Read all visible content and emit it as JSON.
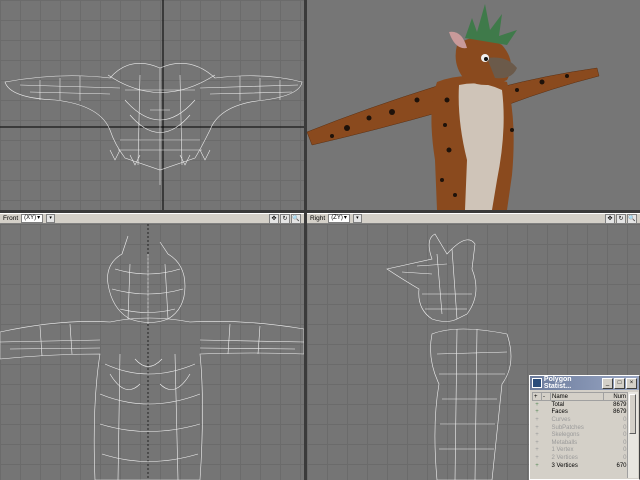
{
  "viewports": {
    "front": {
      "label": "Front",
      "view": "(XY)"
    },
    "right": {
      "label": "Right",
      "view": "(ZY)"
    }
  },
  "polygon_stats": {
    "title": "Polygon Statist...",
    "header_plus": "+",
    "header_minus": "-",
    "col_name": "Name",
    "col_num": "Num",
    "rows": [
      {
        "pm": "+",
        "name": "Total",
        "num": "8679"
      },
      {
        "pm": "+",
        "name": "Faces",
        "num": "8679"
      },
      {
        "pm": "+",
        "name": "Curves",
        "num": "0"
      },
      {
        "pm": "+",
        "name": "SubPatches",
        "num": "0"
      },
      {
        "pm": "+",
        "name": "Skelegons",
        "num": "0"
      },
      {
        "pm": "+",
        "name": "Metaballs",
        "num": "0"
      },
      {
        "pm": "+",
        "name": "1 Vertex",
        "num": "0"
      },
      {
        "pm": "+",
        "name": "2 Vertices",
        "num": "0"
      },
      {
        "pm": "+",
        "name": "3 Vertices",
        "num": "670"
      }
    ]
  },
  "icons": {
    "move": "✥",
    "rotate": "↻",
    "zoom": "🔍",
    "dropdown": "▾",
    "minimize": "_",
    "maximize": "□",
    "close": "×"
  }
}
